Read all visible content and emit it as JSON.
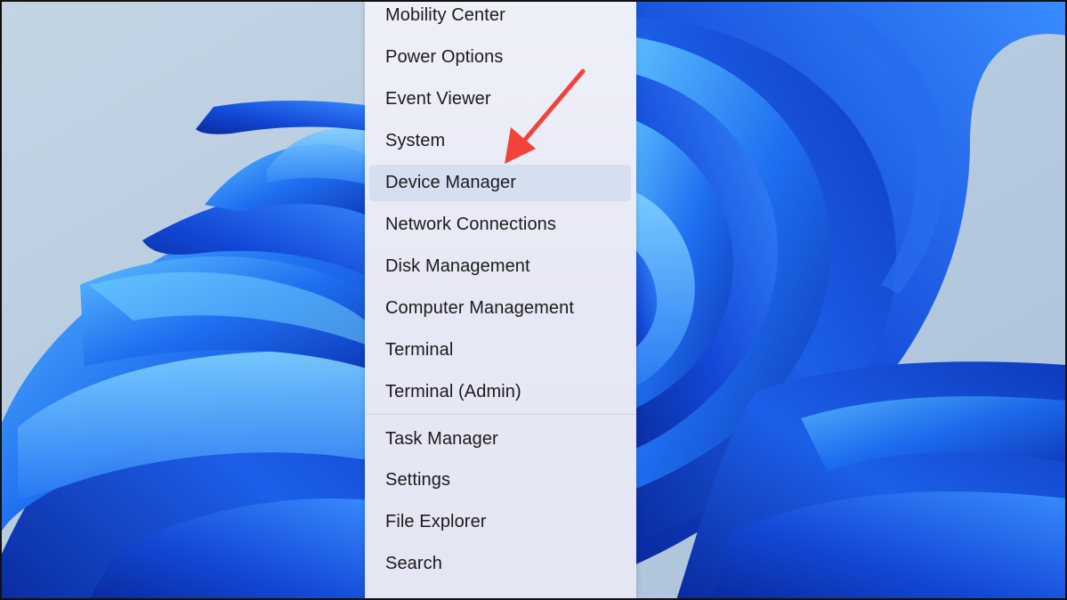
{
  "context_menu": {
    "items": [
      {
        "label": "Mobility Center",
        "name": "menu-item-mobility-center"
      },
      {
        "label": "Power Options",
        "name": "menu-item-power-options"
      },
      {
        "label": "Event Viewer",
        "name": "menu-item-event-viewer"
      },
      {
        "label": "System",
        "name": "menu-item-system"
      },
      {
        "label": "Device Manager",
        "name": "menu-item-device-manager"
      },
      {
        "label": "Network Connections",
        "name": "menu-item-network-connections"
      },
      {
        "label": "Disk Management",
        "name": "menu-item-disk-management"
      },
      {
        "label": "Computer Management",
        "name": "menu-item-computer-management"
      },
      {
        "label": "Terminal",
        "name": "menu-item-terminal"
      },
      {
        "label": "Terminal (Admin)",
        "name": "menu-item-terminal-admin"
      },
      {
        "label": "Task Manager",
        "name": "menu-item-task-manager"
      },
      {
        "label": "Settings",
        "name": "menu-item-settings"
      },
      {
        "label": "File Explorer",
        "name": "menu-item-file-explorer"
      },
      {
        "label": "Search",
        "name": "menu-item-search"
      }
    ],
    "highlighted_item": "Device Manager"
  },
  "annotation": {
    "arrow_color": "#f0433a"
  },
  "colors": {
    "wallpaper_background": "#b9cde0",
    "bloom_dark": "#0a2fa8",
    "bloom_mid": "#1f63e6",
    "bloom_light": "#4fb0ff"
  }
}
